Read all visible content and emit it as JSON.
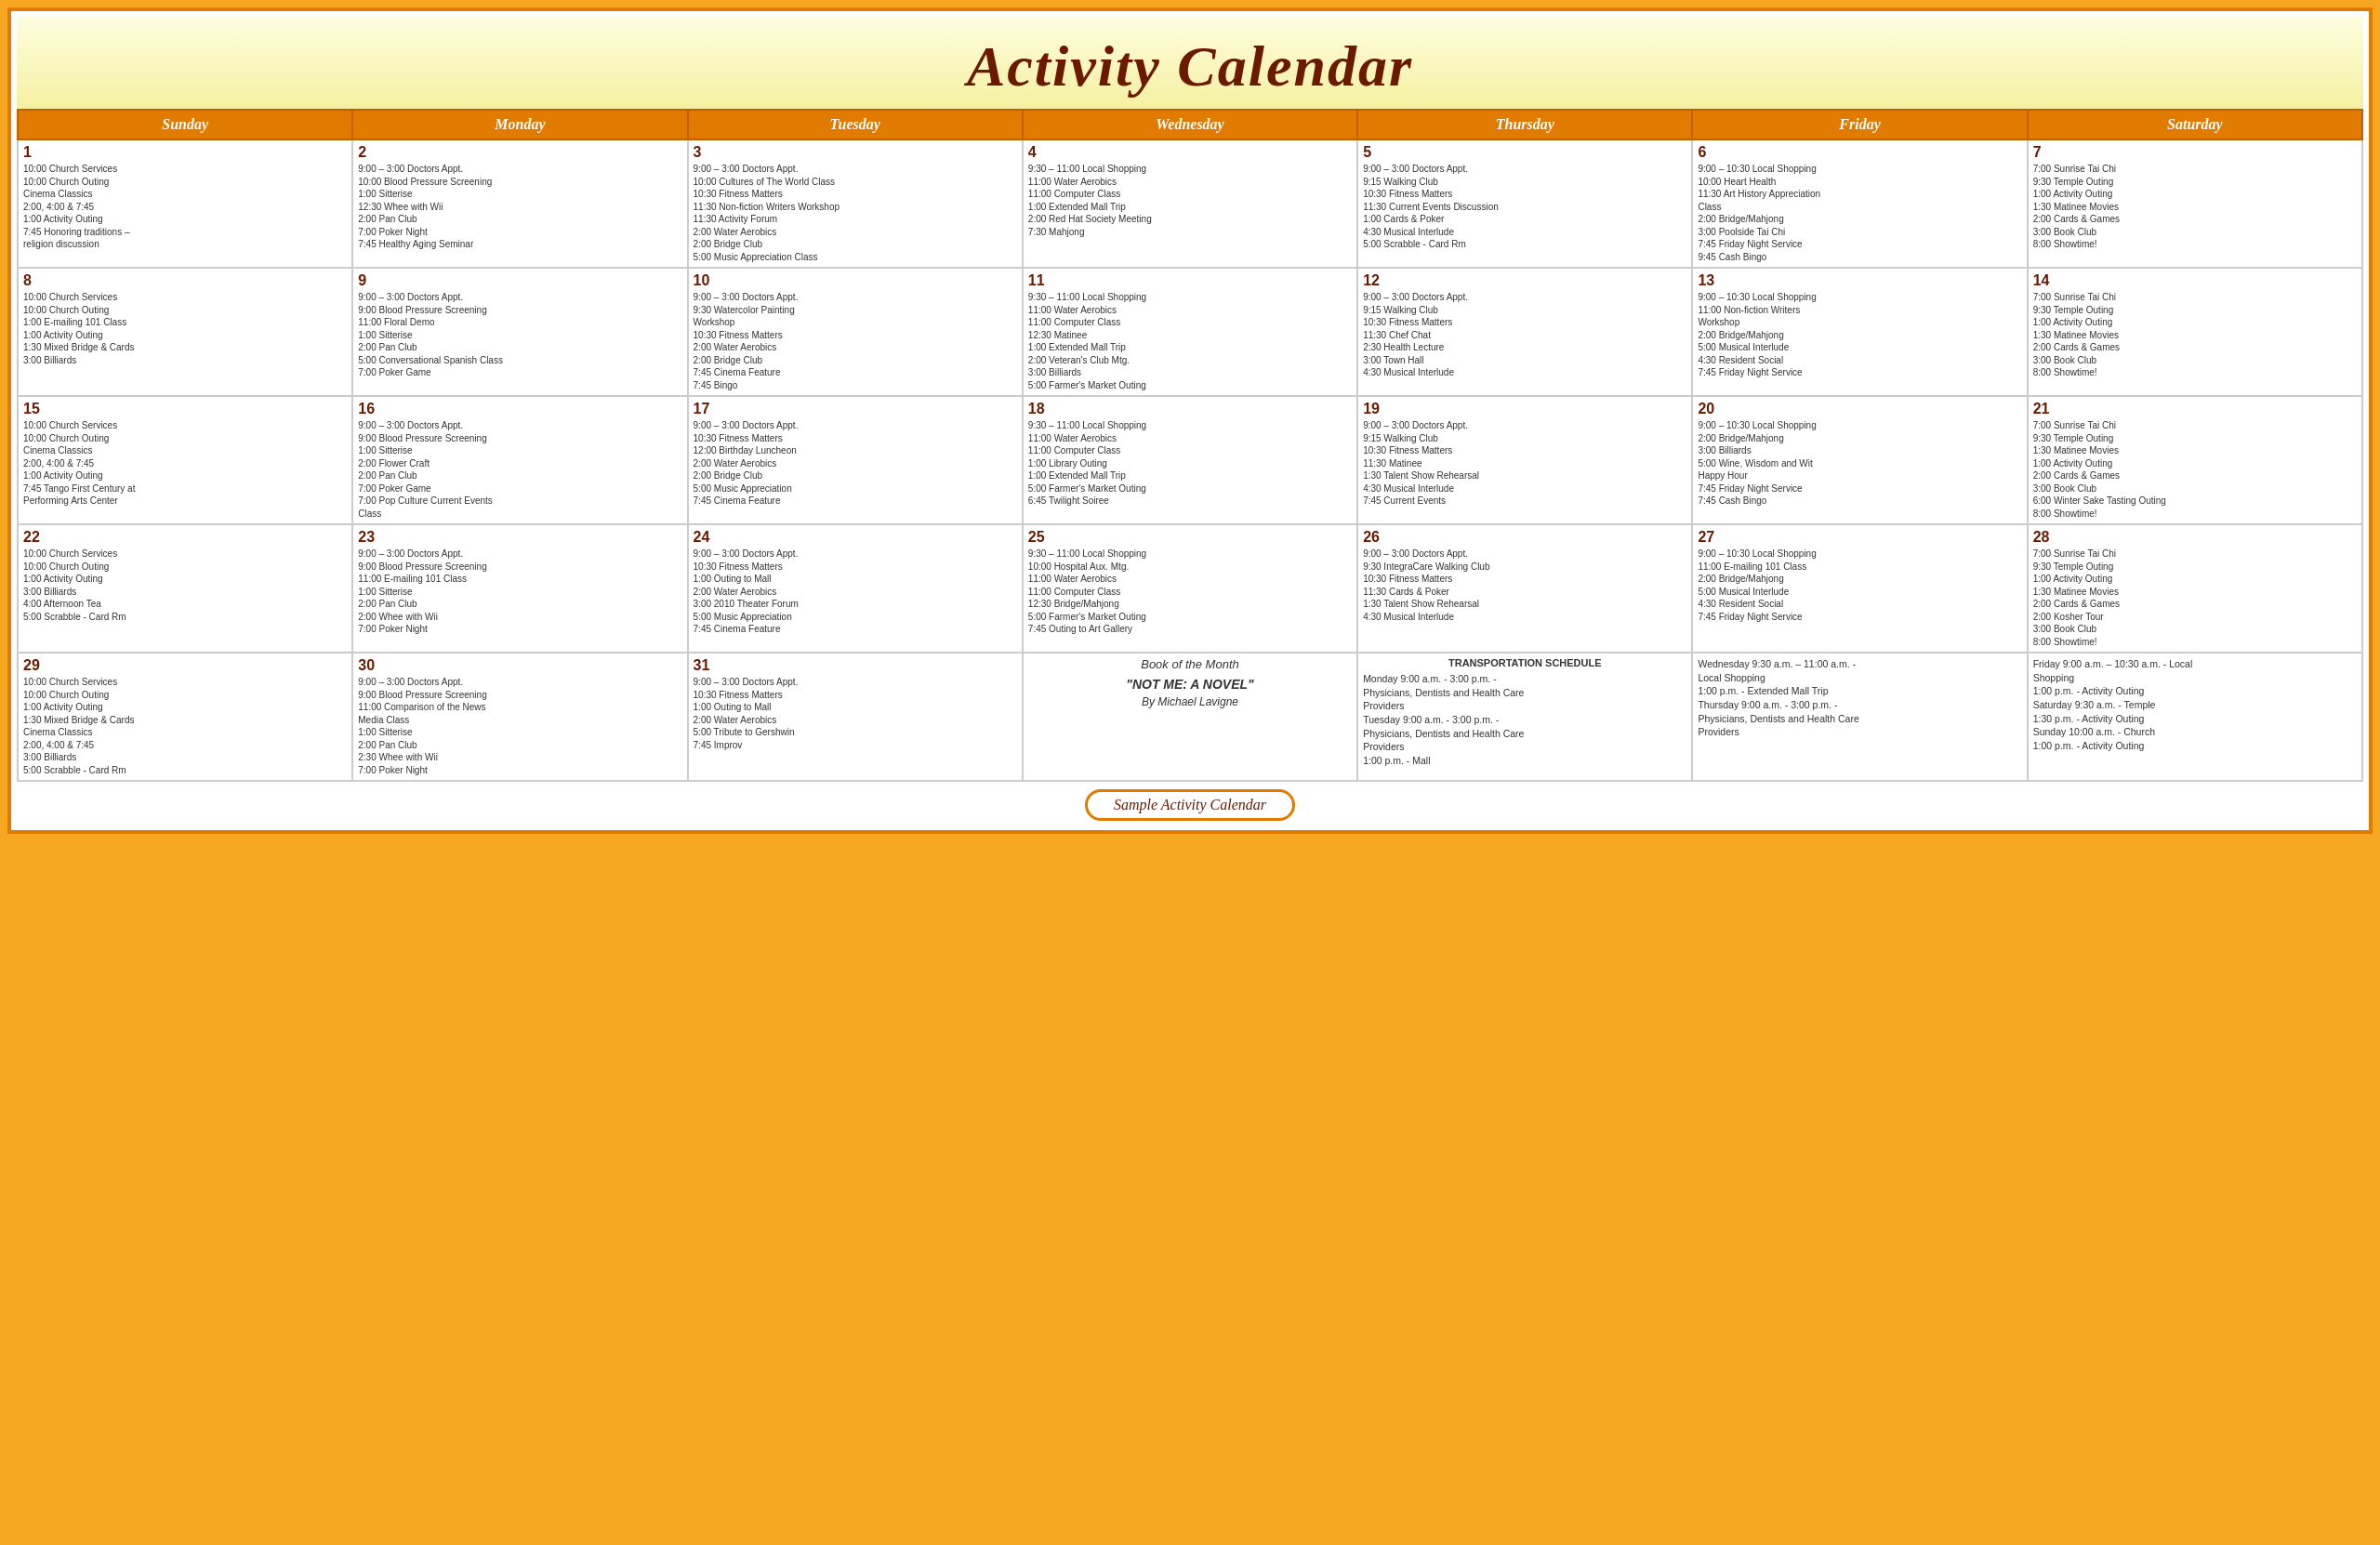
{
  "header": {
    "title": "Activity Calendar"
  },
  "days": [
    "Sunday",
    "Monday",
    "Tuesday",
    "Wednesday",
    "Thursday",
    "Friday",
    "Saturday"
  ],
  "weeks": [
    [
      {
        "num": "1",
        "events": [
          "10:00 Church Services",
          "10:00 Church Outing",
          "Cinema Classics",
          "2:00, 4:00 & 7:45",
          "1:00  Activity Outing",
          "7:45 Honoring traditions –",
          "religion discussion"
        ]
      },
      {
        "num": "2",
        "events": [
          "9:00  –  3:00 Doctors Appt.",
          "10:00 Blood Pressure Screening",
          "1:00 Sitterise",
          "12:30 Whee with Wii",
          "2:00 Pan Club",
          "7:00 Poker Night",
          "7:45 Healthy Aging Seminar"
        ]
      },
      {
        "num": "3",
        "events": [
          "9:00  –  3:00 Doctors Appt.",
          "10:00 Cultures of The World Class",
          "10:30 Fitness Matters",
          "11:30 Non-fiction Writers Workshop",
          "11:30 Activity Forum",
          "2:00 Water Aerobics",
          "2:00 Bridge Club",
          "5:00 Music Appreciation Class"
        ]
      },
      {
        "num": "4",
        "events": [
          "9:30 – 11:00 Local Shopping",
          "11:00 Water Aerobics",
          "11:00 Computer Class",
          "1:00 Extended Mall Trip",
          "2:00 Red Hat Society Meeting",
          "7:30 Mahjong"
        ]
      },
      {
        "num": "5",
        "events": [
          "9:00  –  3:00 Doctors Appt.",
          "9:15 Walking Club",
          "10:30 Fitness Matters",
          "11:30 Current Events Discussion",
          "1:00 Cards & Poker",
          "4:30 Musical Interlude",
          "5:00 Scrabble - Card Rm"
        ]
      },
      {
        "num": "6",
        "events": [
          "9:00 – 10:30 Local Shopping",
          "10:00 Heart Health",
          "11:30 Art History Appreciation",
          "Class",
          "2:00 Bridge/Mahjong",
          "3:00 Poolside Tai Chi",
          "7:45 Friday Night Service",
          "9:45 Cash Bingo"
        ]
      },
      {
        "num": "7",
        "events": [
          "7:00 Sunrise Tai Chi",
          "9:30  Temple Outing",
          "1:00  Activity Outing",
          "1:30 Matinee Movies",
          "2:00 Cards & Games",
          "3:00 Book Club",
          "8:00 Showtime!"
        ]
      }
    ],
    [
      {
        "num": "8",
        "events": [
          "10:00 Church Services",
          "10:00 Church Outing",
          "1:00 E-mailing 101 Class",
          "1:00  Activity Outing",
          "1:30 Mixed Bridge & Cards",
          "3:00 Billiards"
        ]
      },
      {
        "num": "9",
        "events": [
          "9:00  –  3:00 Doctors Appt.",
          "9:00 Blood Pressure Screening",
          "11:00 Floral Demo",
          "1:00 Sitterise",
          "2:00 Pan Club",
          "5:00 Conversational Spanish Class",
          "7:00 Poker Game"
        ]
      },
      {
        "num": "10",
        "events": [
          "9:00  –  3:00 Doctors Appt.",
          "9:30 Watercolor Painting",
          "Workshop",
          "10:30 Fitness Matters",
          "2:00 Water Aerobics",
          "2:00 Bridge Club",
          "7:45 Cinema Feature",
          "7:45 Bingo"
        ]
      },
      {
        "num": "11",
        "events": [
          "9:30 – 11:00 Local Shopping",
          "11:00 Water Aerobics",
          "11:00 Computer Class",
          "12:30 Matinee",
          "1:00 Extended Mall Trip",
          "2:00 Veteran's Club Mtg.",
          "3:00 Billiards",
          "5:00 Farmer's Market Outing"
        ]
      },
      {
        "num": "12",
        "events": [
          "9:00  –  3:00 Doctors Appt.",
          "9:15 Walking Club",
          "10:30 Fitness Matters",
          "11:30 Chef Chat",
          "2:30 Health Lecture",
          "3:00 Town Hall",
          "4:30 Musical Interlude"
        ]
      },
      {
        "num": "13",
        "events": [
          "9:00 – 10:30 Local Shopping",
          "11:00 Non-fiction Writers",
          "Workshop",
          "2:00 Bridge/Mahjong",
          "5:00 Musical Interlude",
          "4:30 Resident Social",
          "7:45 Friday Night Service"
        ]
      },
      {
        "num": "14",
        "events": [
          "7:00 Sunrise Tai Chi",
          "9:30  Temple Outing",
          "1:00  Activity Outing",
          "1:30 Matinee Movies",
          "2:00 Cards & Games",
          "3:00 Book Club",
          "8:00 Showtime!"
        ]
      }
    ],
    [
      {
        "num": "15",
        "events": [
          "10:00 Church Services",
          "10:00 Church Outing",
          "Cinema Classics",
          "2:00, 4:00 & 7:45",
          "1:00  Activity Outing",
          "7:45 Tango First Century at",
          "Performing Arts Center"
        ]
      },
      {
        "num": "16",
        "events": [
          "9:00  –  3:00 Doctors Appt.",
          "9:00 Blood Pressure Screening",
          "1:00 Sitterise",
          "2:00 Flower Craft",
          "2:00 Pan Club",
          "7:00 Poker Game",
          "7:00 Pop Culture Current Events",
          "Class"
        ]
      },
      {
        "num": "17",
        "events": [
          "9:00  –  3:00 Doctors Appt.",
          "10:30 Fitness Matters",
          "12:00 Birthday Luncheon",
          "2:00 Water Aerobics",
          "2:00 Bridge Club",
          "5:00 Music Appreciation",
          "7:45 Cinema Feature"
        ]
      },
      {
        "num": "18",
        "events": [
          "9:30 – 11:00 Local Shopping",
          "11:00 Water Aerobics",
          "11:00 Computer Class",
          "1:00 Library Outing",
          "1:00 Extended Mall Trip",
          "5:00 Farmer's Market Outing",
          "6:45 Twilight Soiree"
        ]
      },
      {
        "num": "19",
        "events": [
          "9:00  –  3:00 Doctors Appt.",
          "9:15 Walking Club",
          "10:30 Fitness Matters",
          "11:30 Matinee",
          "1:30 Talent Show Rehearsal",
          "4:30 Musical Interlude",
          "7:45 Current Events"
        ]
      },
      {
        "num": "20",
        "events": [
          "9:00 – 10:30 Local Shopping",
          "2:00 Bridge/Mahjong",
          "3:00 Billiards",
          "5:00 Wine, Wisdom and Wit",
          "Happy Hour",
          "7:45 Friday Night Service",
          "7:45 Cash Bingo"
        ]
      },
      {
        "num": "21",
        "events": [
          "7:00 Sunrise Tai Chi",
          "9:30  Temple Outing",
          "1:30 Matinee Movies",
          "1:00  Activity Outing",
          "2:00 Cards & Games",
          "3:00 Book Club",
          "6:00 Winter Sake Tasting Outing",
          "8:00 Showtime!"
        ]
      }
    ],
    [
      {
        "num": "22",
        "events": [
          "10:00 Church Services",
          "10:00 Church Outing",
          "1:00  Activity Outing",
          "3:00 Billiards",
          "4:00 Afternoon Tea",
          "5:00 Scrabble - Card Rm"
        ]
      },
      {
        "num": "23",
        "events": [
          "9:00  –  3:00 Doctors Appt.",
          "9:00 Blood Pressure Screening",
          "11:00 E-mailing 101 Class",
          "1:00 Sitterise",
          "2:00 Pan Club",
          "2:00 Whee with Wii",
          "7:00 Poker Night"
        ]
      },
      {
        "num": "24",
        "events": [
          "9:00  –  3:00 Doctors Appt.",
          "10:30 Fitness Matters",
          "1:00 Outing to Mall",
          "2:00 Water Aerobics",
          "3:00 2010 Theater Forum",
          "5:00 Music Appreciation",
          "7:45 Cinema Feature"
        ]
      },
      {
        "num": "25",
        "events": [
          "9:30 – 11:00 Local Shopping",
          "10:00 Hospital Aux. Mtg.",
          "11:00 Water Aerobics",
          "11:00 Computer Class",
          "12:30 Bridge/Mahjong",
          "5:00 Farmer's Market Outing",
          "7:45 Outing to Art Gallery"
        ]
      },
      {
        "num": "26",
        "events": [
          "9:00  –  3:00 Doctors Appt.",
          "9:30 IntegraCare Walking Club",
          "10:30 Fitness Matters",
          "11:30 Cards & Poker",
          "1:30 Talent Show Rehearsal",
          "4:30 Musical Interlude"
        ]
      },
      {
        "num": "27",
        "events": [
          "9:00 – 10:30 Local Shopping",
          "11:00 E-mailing 101 Class",
          "2:00 Bridge/Mahjong",
          "5:00 Musical Interlude",
          "4:30 Resident Social",
          "7:45 Friday Night Service"
        ]
      },
      {
        "num": "28",
        "events": [
          "7:00 Sunrise Tai Chi",
          "9:30  Temple Outing",
          "1:00  Activity Outing",
          "1:30 Matinee Movies",
          "2:00 Cards & Games",
          "2:00 Kosher Tour",
          "3:00 Book Club",
          "8:00 Showtime!"
        ]
      }
    ],
    [
      {
        "num": "29",
        "events": [
          "10:00 Church Services",
          "10:00 Church Outing",
          "1:00  Activity Outing",
          "1:30 Mixed Bridge & Cards",
          "Cinema Classics",
          "2:00, 4:00 & 7:45",
          "3:00 Billiards",
          "5:00 Scrabble - Card Rm"
        ]
      },
      {
        "num": "30",
        "events": [
          "9:00  –  3:00 Doctors Appt.",
          "9:00 Blood Pressure Screening",
          "11:00 Comparison of the News",
          "Media Class",
          "1:00 Sitterise",
          "2:00 Pan Club",
          "2:30 Whee with Wii",
          "7:00 Poker Night"
        ]
      },
      {
        "num": "31",
        "events": [
          "9:00  –  3:00 Doctors Appt.",
          "10:30 Fitness Matters",
          "1:00 Outing to Mall",
          "2:00 Water Aerobics",
          "5:00 Tribute to Gershwin",
          "7:45 Improv"
        ]
      },
      {
        "book": true,
        "book_title": "Book of the Month",
        "book_name": "\"NOT ME: A NOVEL\"",
        "book_author": "By Michael Lavigne"
      },
      {
        "transport": true,
        "title": "TRANSPORTATION SCHEDULE",
        "lines": [
          "Monday 9:00 a.m. - 3:00 p.m. -",
          "Physicians, Dentists and Health Care",
          "Providers",
          "Tuesday 9:00 a.m. - 3:00 p.m. -",
          "Physicians, Dentists and Health Care",
          "Providers",
          "1:00 p.m. - Mall"
        ]
      },
      {
        "transport": true,
        "title": "",
        "lines": [
          "Wednesday 9:30 a.m. – 11:00 a.m. -",
          "Local Shopping",
          "1:00 p.m. - Extended Mall Trip",
          "Thursday 9:00 a.m. - 3:00 p.m. -",
          "Physicians, Dentists and Health Care",
          "Providers"
        ]
      },
      {
        "transport": true,
        "title": "",
        "lines": [
          "Friday 9:00 a.m. – 10:30 a.m. - Local",
          "Shopping",
          "1:00 p.m. - Activity Outing",
          "Saturday 9:30 a.m. - Temple",
          "1:30 p.m. - Activity Outing",
          "Sunday 10:00 a.m. - Church",
          "1:00 p.m. - Activity Outing"
        ]
      }
    ]
  ],
  "footer": {
    "label": "Sample Activity Calendar"
  }
}
